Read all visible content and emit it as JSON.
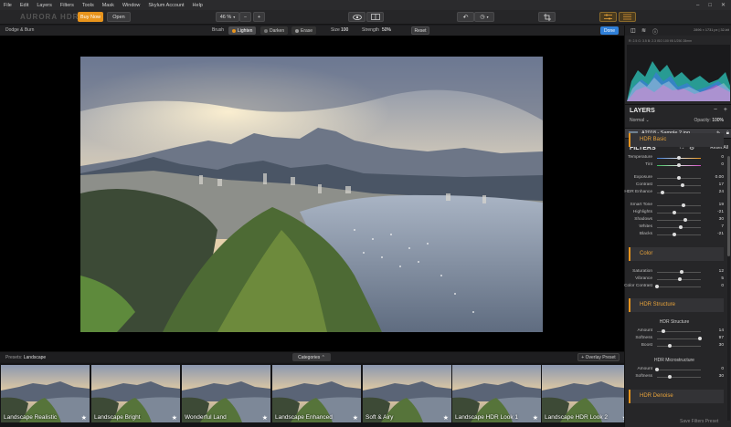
{
  "menu": [
    "File",
    "Edit",
    "Layers",
    "Filters",
    "Tools",
    "Mask",
    "Window",
    "Skylum Account",
    "Help"
  ],
  "window_controls": [
    "–",
    "□",
    "✕"
  ],
  "toolbar": {
    "logo": "AURORA HDR",
    "buy_now": "Buy Now",
    "open": "Open",
    "zoom": "46 %",
    "zoom_out": "−",
    "zoom_in": "+"
  },
  "options": {
    "mode_label": "Dodge & Burn",
    "brush_label": "Brush",
    "lighten": "Lighten",
    "darken": "Darken",
    "erase": "Erase",
    "size_label": "Size",
    "size_value": "100",
    "strength_label": "Strength",
    "strength_value": "50%",
    "reset": "Reset",
    "done": "Done"
  },
  "presets_bar": {
    "label": "Presets:",
    "category": "Landscape",
    "categories_btn": "Categories ⌃",
    "overlay_btn": "+ Overlay Preset"
  },
  "presets": [
    {
      "label": "Landscape Realistic"
    },
    {
      "label": "Landscape Bright"
    },
    {
      "label": "Wonderful Land"
    },
    {
      "label": "Landscape Enhanced"
    },
    {
      "label": "Soft & Airy"
    },
    {
      "label": "Landscape HDR Look 1"
    },
    {
      "label": "Landscape HDR Look 2"
    }
  ],
  "panel": {
    "hist_info": "R: 2.5  G: 3.5  B: 2.3   ISO 100   f/8   1/250   28mm",
    "dims": "2896 × 1731 px  |  32-bit",
    "layers_title": "LAYERS",
    "blend_mode": "Normal ⌄",
    "opacity_label": "Opacity:",
    "opacity_value": "100%",
    "layer_name": "A2018 - Sample 2.jpg",
    "filters_title": "FILTERS",
    "reset_all": "Reset All",
    "save_filters_preset": "Save Filters Preset"
  },
  "sections": {
    "hdr_basic": "HDR Basic",
    "color": "Color",
    "hdr_structure": "HDR Structure",
    "hdr_denoise": "HDR Denoise",
    "sub_hdr_structure": "HDR Structure",
    "sub_hdr_micro": "HDR Microstructure"
  },
  "sliders": {
    "temperature": {
      "label": "Temperature",
      "value": "0",
      "level": 0.5
    },
    "tint": {
      "label": "Tint",
      "value": "0",
      "level": 0.5
    },
    "exposure": {
      "label": "Exposure",
      "value": "0.00",
      "level": 0.5
    },
    "contrast": {
      "label": "Contrast",
      "value": "17",
      "level": 0.585
    },
    "hdr_enhance": {
      "label": "HDR Enhance",
      "value": "24",
      "level": 0.12
    },
    "smart_tone": {
      "label": "Smart Tone",
      "value": "19",
      "level": 0.595
    },
    "highlights": {
      "label": "Highlights",
      "value": "-21",
      "level": 0.395
    },
    "shadows": {
      "label": "Shadows",
      "value": "30",
      "level": 0.65
    },
    "whites": {
      "label": "Whites",
      "value": "7",
      "level": 0.535
    },
    "blacks": {
      "label": "Blacks",
      "value": "-21",
      "level": 0.395
    },
    "saturation": {
      "label": "Saturation",
      "value": "12",
      "level": 0.56
    },
    "vibrance": {
      "label": "Vibrance",
      "value": "5",
      "level": 0.525
    },
    "color_contrast": {
      "label": "Color Contrast",
      "value": "0",
      "level": 0.0
    },
    "amount": {
      "label": "Amount",
      "value": "14",
      "level": 0.14
    },
    "softness": {
      "label": "Softness",
      "value": "97",
      "level": 0.97
    },
    "boost": {
      "label": "Boost",
      "value": "30",
      "level": 0.3
    },
    "micro_amount": {
      "label": "Amount",
      "value": "0",
      "level": 0.0
    },
    "micro_softness": {
      "label": "Softness",
      "value": "30",
      "level": 0.3
    }
  },
  "colors": {
    "accent": "#e8941c",
    "done_blue": "#2f7fd8",
    "panel": "#262628"
  }
}
